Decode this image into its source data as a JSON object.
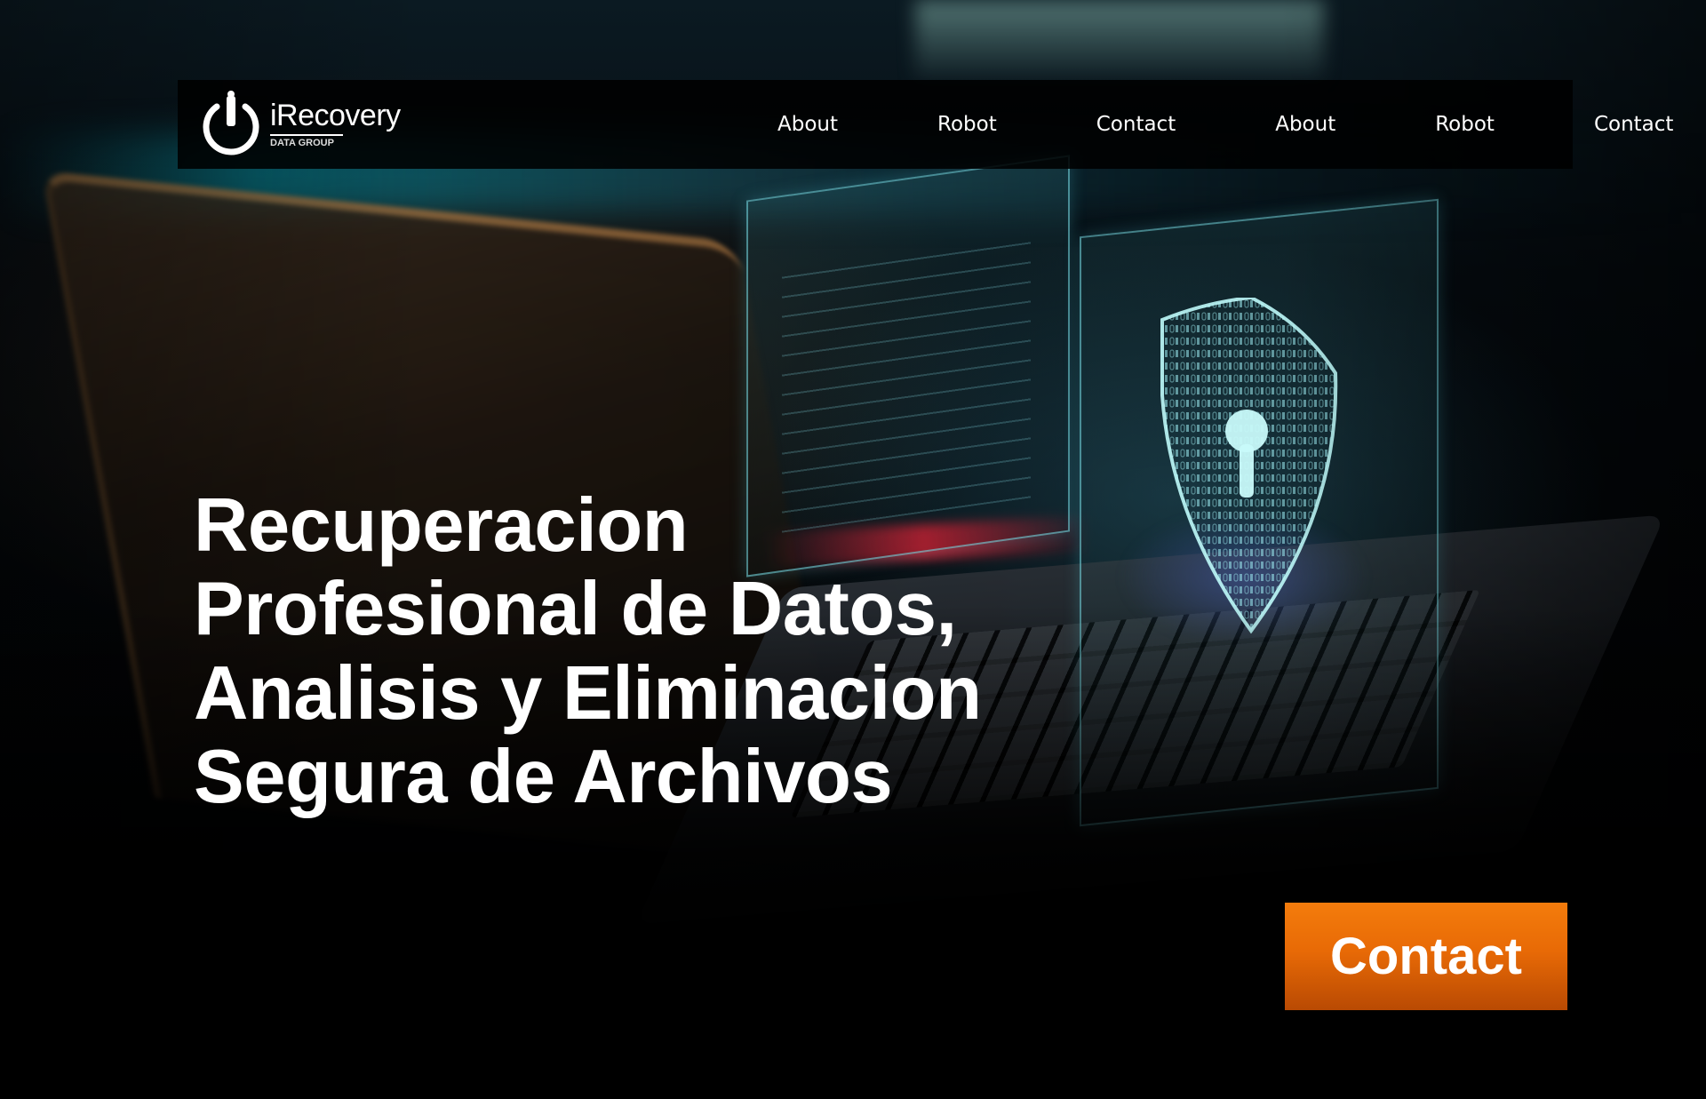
{
  "brand": {
    "name": "iRecovery",
    "tagline": "DATA GROUP"
  },
  "nav": {
    "items": [
      {
        "label": "About"
      },
      {
        "label": "Robot"
      },
      {
        "label": "Contact"
      },
      {
        "label": "About"
      },
      {
        "label": "Robot"
      },
      {
        "label": "Contact"
      }
    ]
  },
  "hero": {
    "headline_lines": [
      "Recuperacion",
      "Profesional de Datos,",
      "Analisis y Eliminacion",
      "Segura de Archivos"
    ],
    "cta_label": "Contact"
  },
  "colors": {
    "background": "#000000",
    "accent_cyan": "#6fdde6",
    "cta_orange": "#f47c0c",
    "text": "#ffffff"
  },
  "icons": {
    "logo": "power-icon",
    "hero_graphic": "shield-lock-icon"
  }
}
